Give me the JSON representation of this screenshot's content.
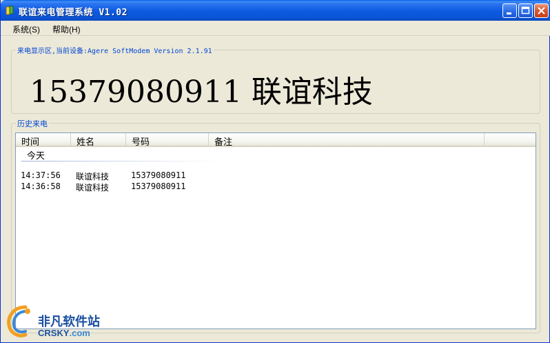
{
  "window": {
    "title": "联谊来电管理系统 V1.02"
  },
  "menu": [
    {
      "label": "系统(S)"
    },
    {
      "label": "帮助(H)"
    }
  ],
  "caller_group": {
    "title": "来电显示区,当前设备:Agere SoftModem Version 2.1.91",
    "display": "15379080911  联谊科技"
  },
  "history_group": {
    "title": "历史来电"
  },
  "history_list": {
    "columns": [
      "时间",
      "姓名",
      "号码",
      "备注"
    ],
    "group_label": "今天",
    "rows": [
      {
        "time": "14:37:56",
        "name": "联谊科技",
        "number": "15379080911",
        "note": ""
      },
      {
        "time": "14:36:58",
        "name": "联谊科技",
        "number": "15379080911",
        "note": ""
      }
    ]
  },
  "watermark": {
    "cn": "非凡软件站",
    "en_main": "CRSKY",
    "en_suffix": ".com"
  },
  "colors": {
    "titlebar": "#0b54d6",
    "group_title": "#0046d5",
    "window_bg": "#ece9d8"
  }
}
